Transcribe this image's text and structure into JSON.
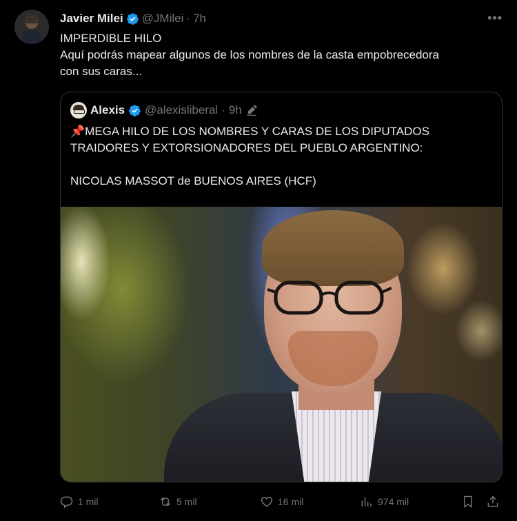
{
  "tweet": {
    "author_name": "Javier Milei",
    "handle": "@JMilei",
    "separator": "·",
    "time": "7h",
    "more_label": "•••",
    "text_lines": [
      "IMPERDIBLE HILO",
      "Aquí podrás mapear algunos de los nombres de la casta empobrecedora",
      "con sus caras..."
    ]
  },
  "quote": {
    "author_name": "Alexis",
    "handle": "@alexisliberal",
    "separator": "·",
    "time": "9h",
    "text_lines": [
      "📌MEGA HILO DE LOS NOMBRES Y CARAS DE LOS DIPUTADOS",
      "TRAIDORES Y EXTORSIONADORES DEL PUEBLO ARGENTINO:",
      "",
      "NICOLAS MASSOT de BUENOS AIRES (HCF)"
    ]
  },
  "actions": {
    "replies": "1 mil",
    "reposts": "5 mil",
    "likes": "16 mil",
    "views": "974 mil"
  },
  "colors": {
    "background": "#000000",
    "text": "#e7e9ea",
    "muted": "#71767b",
    "verified": "#1d9bf0",
    "border": "#2f3336"
  }
}
